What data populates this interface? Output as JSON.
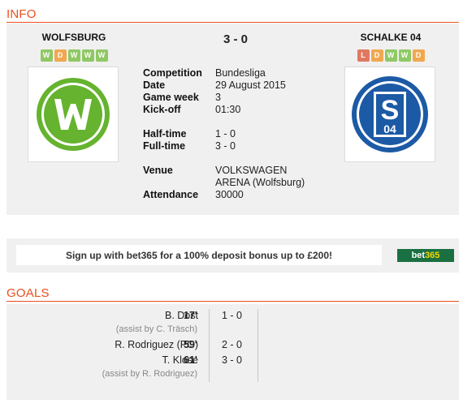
{
  "info": {
    "section_title": "INFO",
    "score": "3 - 0",
    "home": {
      "name": "WOLFSBURG",
      "form": [
        "W",
        "D",
        "W",
        "W",
        "W"
      ],
      "logo_color": "#65b32e"
    },
    "away": {
      "name": "SCHALKE 04",
      "form": [
        "L",
        "D",
        "W",
        "W",
        "D"
      ],
      "logo_color": "#1c5aa5"
    },
    "details": [
      {
        "label": "Competition",
        "value": "Bundesliga"
      },
      {
        "label": "Date",
        "value": "29 August 2015"
      },
      {
        "label": "Game week",
        "value": "3"
      },
      {
        "label": "Kick-off",
        "value": "01:30"
      },
      {
        "label": "Half-time",
        "value": "1 - 0"
      },
      {
        "label": "Full-time",
        "value": "3 - 0"
      },
      {
        "label": "Venue",
        "value": "VOLKSWAGEN"
      },
      {
        "label": "",
        "value": "ARENA (Wolfsburg)"
      },
      {
        "label": "Attendance",
        "value": "30000"
      }
    ]
  },
  "ad": {
    "text": "Sign up with bet365 for a 100% deposit bonus up to £200!",
    "logo_text_main": "bet",
    "logo_text_num": "365"
  },
  "goals": {
    "section_title": "GOALS",
    "items": [
      {
        "scorer": "B. Dost",
        "minute": "17'",
        "score": "1 - 0",
        "assist": "(assist by C. Träsch)"
      },
      {
        "scorer": "R. Rodriguez (PG)",
        "minute": "59'",
        "score": "2 - 0",
        "assist": ""
      },
      {
        "scorer": "T. Klose",
        "minute": "61'",
        "score": "3 - 0",
        "assist": "(assist by R. Rodriguez)"
      }
    ]
  },
  "colors": {
    "accent": "#e8501e",
    "panel": "#f0f0f0",
    "win": "#8fc864",
    "draw": "#f0a850",
    "loss": "#e07860",
    "bet365": "#1a7040"
  }
}
